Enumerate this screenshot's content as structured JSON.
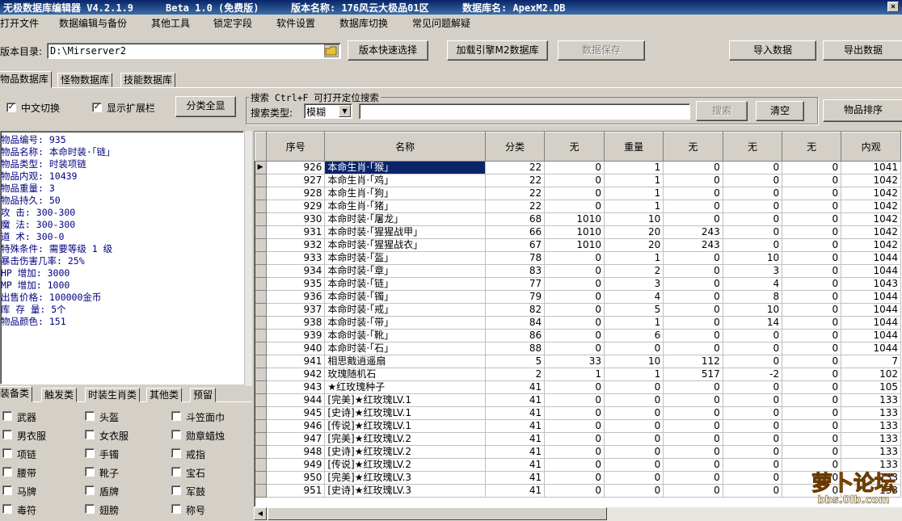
{
  "window": {
    "title": "无极数据库编辑器 V4.2.1.9",
    "beta": "Beta 1.0 (免费版)",
    "version_name": "版本名称: 176风云大极品01区",
    "db_name": "数据库名: ApexM2.DB",
    "close_glyph": "×"
  },
  "menu": [
    "打开文件",
    "数据编辑与备份",
    "其他工具",
    "锁定字段",
    "软件设置",
    "数据库切换",
    "常见问题解疑"
  ],
  "toolbar": {
    "dir_label": "版本目录:",
    "dir_value": "D:\\Mirserver2",
    "quick_select": "版本快速选择",
    "load_engine": "加载引擎M2数据库",
    "save": "数据保存",
    "import": "导入数据",
    "export": "导出数据"
  },
  "db_tabs": [
    "物品数据库",
    "怪物数据库",
    "技能数据库"
  ],
  "options": {
    "chinese_switch": "中文切换",
    "show_ext": "显示扩展栏",
    "expand_all": "分类全显"
  },
  "search": {
    "group_label": "搜索  Ctrl+F 可打开定位搜索",
    "type_label": "搜索类型:",
    "type_value": "模糊",
    "search_btn": "搜索",
    "clear_btn": "清空",
    "sort_btn": "物品排序"
  },
  "info": [
    "物品编号: 935",
    "物品名称: 本命时装·「链」",
    "物品类型: 时装项链",
    "物品内观: 10439",
    "物品重量: 3",
    "物品持久: 50",
    "攻    击: 300-300",
    "魔    法: 300-300",
    "道    术: 300-0",
    "特殊条件: 需要等级 1 级",
    "暴击伤害几率: 25%",
    "HP  增加: 3000",
    "MP  增加: 1000",
    "出售价格: 100000金币",
    "库 存 量: 5个",
    "物品颜色: 151"
  ],
  "category_tabs": [
    "装备类",
    "触发类",
    "时装生肖类",
    "其他类",
    "预留"
  ],
  "categories": [
    [
      "武器",
      "头盔",
      "斗笠面巾"
    ],
    [
      "男衣服",
      "女衣服",
      "勋章蜡烛"
    ],
    [
      "项链",
      "手镯",
      "戒指"
    ],
    [
      "腰带",
      "靴子",
      "宝石"
    ],
    [
      "马牌",
      "盾牌",
      "军鼓"
    ],
    [
      "毒符",
      "翅膀",
      "称号"
    ]
  ],
  "grid": {
    "columns": [
      "序号",
      "名称",
      "分类",
      "无",
      "重量",
      "无",
      "无",
      "无",
      "内观"
    ],
    "rows": [
      [
        "926",
        "本命生肖·「猴」",
        "22",
        "0",
        "1",
        "0",
        "0",
        "0",
        "1041"
      ],
      [
        "927",
        "本命生肖·「鸡」",
        "22",
        "0",
        "1",
        "0",
        "0",
        "0",
        "1042"
      ],
      [
        "928",
        "本命生肖·「狗」",
        "22",
        "0",
        "1",
        "0",
        "0",
        "0",
        "1042"
      ],
      [
        "929",
        "本命生肖·「猪」",
        "22",
        "0",
        "1",
        "0",
        "0",
        "0",
        "1042"
      ],
      [
        "930",
        "本命时装·「屠龙」",
        "68",
        "1010",
        "10",
        "0",
        "0",
        "0",
        "1042"
      ],
      [
        "931",
        "本命时装·「猩猩战甲」",
        "66",
        "1010",
        "20",
        "243",
        "0",
        "0",
        "1042"
      ],
      [
        "932",
        "本命时装·「猩猩战衣」",
        "67",
        "1010",
        "20",
        "243",
        "0",
        "0",
        "1042"
      ],
      [
        "933",
        "本命时装·「盔」",
        "78",
        "0",
        "1",
        "0",
        "10",
        "0",
        "1044"
      ],
      [
        "934",
        "本命时装·「章」",
        "83",
        "0",
        "2",
        "0",
        "3",
        "0",
        "1044"
      ],
      [
        "935",
        "本命时装·「链」",
        "77",
        "0",
        "3",
        "0",
        "4",
        "0",
        "1043"
      ],
      [
        "936",
        "本命时装·「镯」",
        "79",
        "0",
        "4",
        "0",
        "8",
        "0",
        "1044"
      ],
      [
        "937",
        "本命时装·「戒」",
        "82",
        "0",
        "5",
        "0",
        "10",
        "0",
        "1044"
      ],
      [
        "938",
        "本命时装·「带」",
        "84",
        "0",
        "1",
        "0",
        "14",
        "0",
        "1044"
      ],
      [
        "939",
        "本命时装·「靴」",
        "86",
        "0",
        "6",
        "0",
        "0",
        "0",
        "1044"
      ],
      [
        "940",
        "本命时装·「石」",
        "88",
        "0",
        "0",
        "0",
        "0",
        "0",
        "1044"
      ],
      [
        "941",
        "相思戭逍遥扇",
        "5",
        "33",
        "10",
        "112",
        "0",
        "0",
        "7"
      ],
      [
        "942",
        "玫瑰随机石",
        "2",
        "1",
        "1",
        "517",
        "-2",
        "0",
        "102"
      ],
      [
        "943",
        "★红玫瑰种子",
        "41",
        "0",
        "0",
        "0",
        "0",
        "0",
        "105"
      ],
      [
        "944",
        "[完美]★红玫瑰LV.1",
        "41",
        "0",
        "0",
        "0",
        "0",
        "0",
        "133"
      ],
      [
        "945",
        "[史诗]★红玫瑰LV.1",
        "41",
        "0",
        "0",
        "0",
        "0",
        "0",
        "133"
      ],
      [
        "946",
        "[传说]★红玫瑰LV.1",
        "41",
        "0",
        "0",
        "0",
        "0",
        "0",
        "133"
      ],
      [
        "947",
        "[完美]★红玫瑰LV.2",
        "41",
        "0",
        "0",
        "0",
        "0",
        "0",
        "133"
      ],
      [
        "948",
        "[史诗]★红玫瑰LV.2",
        "41",
        "0",
        "0",
        "0",
        "0",
        "0",
        "133"
      ],
      [
        "949",
        "[传说]★红玫瑰LV.2",
        "41",
        "0",
        "0",
        "0",
        "0",
        "0",
        "133"
      ],
      [
        "950",
        "[完美]★红玫瑰LV.3",
        "41",
        "0",
        "0",
        "0",
        "0",
        "0",
        "133"
      ],
      [
        "951",
        "[史诗]★红玫瑰LV.3",
        "41",
        "0",
        "0",
        "0",
        "0",
        "0",
        "133"
      ]
    ],
    "selected_index": 0,
    "row_pointer": "▶"
  },
  "watermark": {
    "text": "萝卜论坛",
    "url": "bbs.0lb.com"
  },
  "colors": {
    "title_bar": "#0a246a",
    "selection": "#0a246a",
    "info_text": "#000080"
  }
}
